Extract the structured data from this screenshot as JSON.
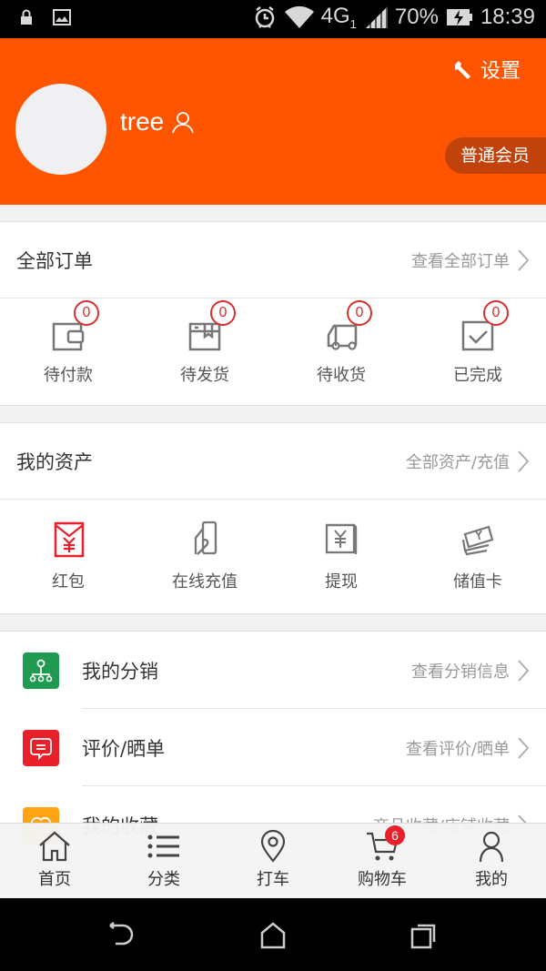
{
  "status_bar": {
    "left_icons": [
      "lock-icon",
      "image-icon"
    ],
    "right_icons": [
      "alarm-icon",
      "wifi-icon",
      "signal-icon",
      "battery-charging-icon"
    ],
    "network": "4G",
    "sim": "1",
    "battery": "70%",
    "time": "18:39"
  },
  "header": {
    "settings_label": "设置",
    "username": "tree",
    "member_level": "普通会员",
    "bg_color": "#ff5500"
  },
  "orders": {
    "title": "全部订单",
    "link": "查看全部订单",
    "items": [
      {
        "label": "待付款",
        "count": "0",
        "icon": "wallet-icon"
      },
      {
        "label": "待发货",
        "count": "0",
        "icon": "package-icon"
      },
      {
        "label": "待收货",
        "count": "0",
        "icon": "truck-icon"
      },
      {
        "label": "已完成",
        "count": "0",
        "icon": "check-box-icon"
      }
    ]
  },
  "assets": {
    "title": "我的资产",
    "link": "全部资产/充值",
    "items": [
      {
        "label": "红包",
        "icon": "red-envelope-icon"
      },
      {
        "label": "在线充值",
        "icon": "recharge-card-icon"
      },
      {
        "label": "提现",
        "icon": "withdraw-icon"
      },
      {
        "label": "储值卡",
        "icon": "stored-value-card-icon"
      }
    ]
  },
  "menu": [
    {
      "title": "我的分销",
      "link": "查看分销信息",
      "icon": "distribution-tree-icon",
      "color": "#1e9b4f"
    },
    {
      "title": "评价/晒单",
      "link": "查看评价/晒单",
      "icon": "comment-icon",
      "color": "#e8202a"
    },
    {
      "title": "我的收藏",
      "link": "商品收藏/店铺收藏",
      "icon": "heart-icon",
      "color": "#ffa214"
    }
  ],
  "tabbar": [
    {
      "label": "首页",
      "icon": "home-icon"
    },
    {
      "label": "分类",
      "icon": "list-icon"
    },
    {
      "label": "打车",
      "icon": "location-pin-icon"
    },
    {
      "label": "购物车",
      "icon": "cart-icon",
      "badge": "6"
    },
    {
      "label": "我的",
      "icon": "user-icon"
    }
  ],
  "nav": [
    "back-icon",
    "home-icon",
    "recents-icon"
  ]
}
